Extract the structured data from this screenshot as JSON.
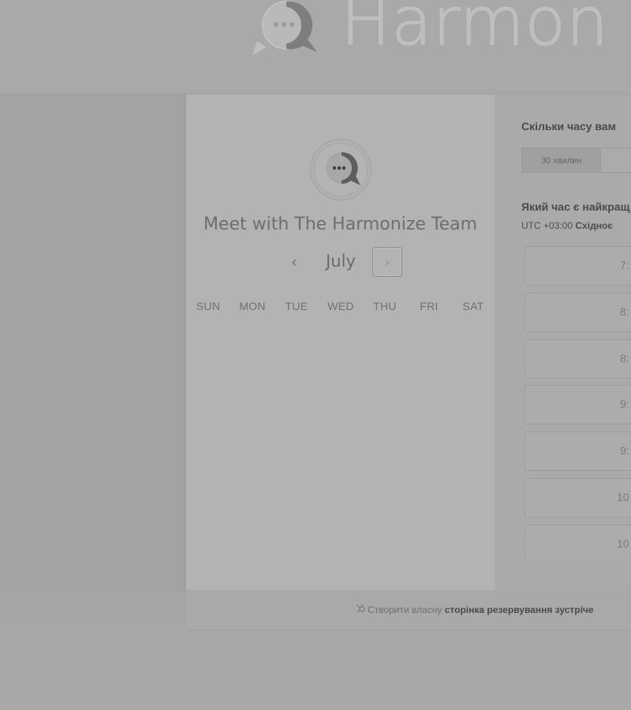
{
  "brand": {
    "logo_icon": "chat-bubble-logo-icon",
    "wordmark": "Harmon"
  },
  "organizer": {
    "avatar_icon": "chat-bubble-avatar-icon",
    "title": "Meet with The Harmonize Team"
  },
  "calendar": {
    "month": "July",
    "prev_icon": "chevron-left-icon",
    "next_icon": "chevron-right-icon",
    "weekdays": [
      "SUN",
      "MON",
      "TUE",
      "WED",
      "THU",
      "FRI",
      "SAT"
    ]
  },
  "duration": {
    "question": "Скільки часу вам",
    "options": [
      "30 хвилин",
      ""
    ]
  },
  "time": {
    "question": "Який час є найкращ",
    "timezone_offset": "UTC +03:00",
    "timezone_name": "Східноє",
    "slots": [
      "7:",
      "8:",
      "8:",
      "9:",
      "9:",
      "10",
      "10"
    ]
  },
  "footer": {
    "icon": "hubspot-sprocket-icon",
    "prefix": "Створити власну",
    "link": "сторінка резервування зустріче"
  },
  "colors": {
    "overlay_grey": "#a8a8a8",
    "card_left": "#b3b3b3",
    "card_right": "#aaaaaa",
    "text_dark": "#4a4a4a"
  }
}
